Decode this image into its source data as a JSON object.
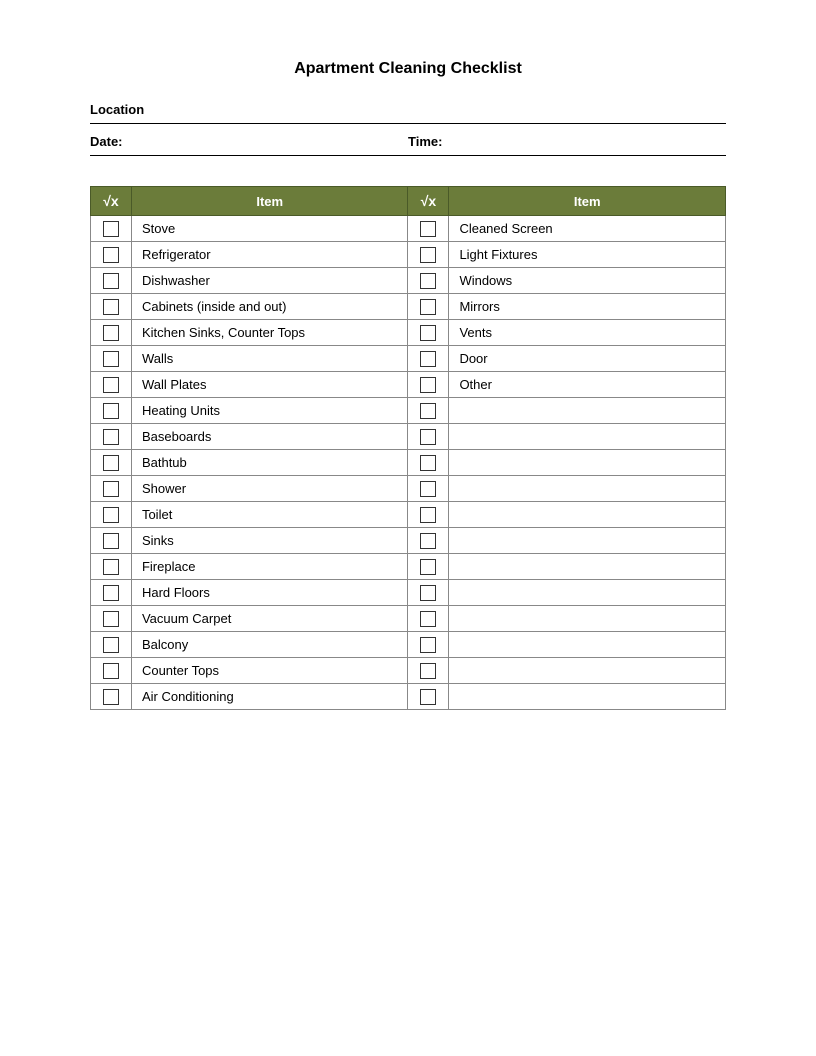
{
  "page": {
    "title": "Apartment Cleaning Checklist",
    "location_label": "Location",
    "date_label": "Date:",
    "time_label": "Time:",
    "table": {
      "header_icon": "√x",
      "header_item": "Item",
      "left_items": [
        "Stove",
        "Refrigerator",
        "Dishwasher",
        "Cabinets  (inside and out)",
        "Kitchen Sinks, Counter Tops",
        "Walls",
        "Wall Plates",
        "Heating Units",
        "Baseboards",
        "Bathtub",
        "Shower",
        "Toilet",
        "Sinks",
        "Fireplace",
        "Hard Floors",
        "Vacuum Carpet",
        "Balcony",
        "Counter Tops",
        "Air Conditioning"
      ],
      "right_items": [
        "Cleaned Screen",
        "Light Fixtures",
        "Windows",
        "Mirrors",
        "Vents",
        "Door",
        "Other",
        "",
        "",
        "",
        "",
        "",
        "",
        "",
        "",
        "",
        "",
        "",
        ""
      ]
    }
  }
}
